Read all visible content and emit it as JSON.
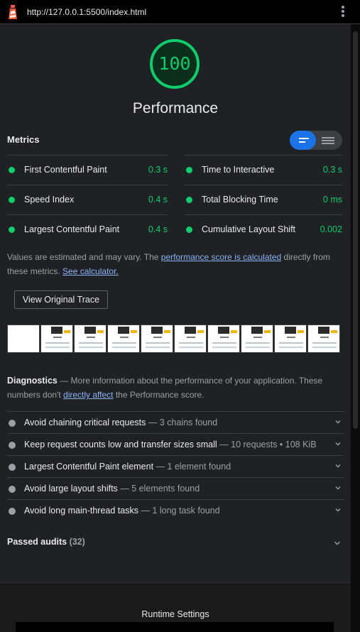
{
  "browser": {
    "url": "http://127.0.0.1:5500/index.html",
    "logo_icon": "lighthouse-icon",
    "menu_icon": "kebab-menu-icon"
  },
  "category": {
    "score": "100",
    "title": "Performance",
    "score_color": "#0cce6b"
  },
  "metrics": {
    "title": "Metrics",
    "view_toggle": {
      "active": "list-view-icon",
      "inactive": "table-view-icon",
      "accent": "#1a73e8"
    },
    "left": [
      {
        "label": "First Contentful Paint",
        "value": "0.3 s"
      },
      {
        "label": "Speed Index",
        "value": "0.4 s"
      },
      {
        "label": "Largest Contentful Paint",
        "value": "0.4 s"
      }
    ],
    "right": [
      {
        "label": "Time to Interactive",
        "value": "0.3 s"
      },
      {
        "label": "Total Blocking Time",
        "value": "0 ms"
      },
      {
        "label": "Cumulative Layout Shift",
        "value": "0.002"
      }
    ],
    "pass_color": "#0cce6b"
  },
  "note": {
    "text1": "Values are estimated and may vary. The ",
    "link1": "performance score is calculated",
    "text2": " directly from these metrics. ",
    "link2": "See calculator."
  },
  "trace_button": "View Original Trace",
  "diagnostics": {
    "title": "Diagnostics",
    "dash": " — ",
    "desc1": "More information about the performance of your application. These numbers don't ",
    "link": "directly affect",
    "desc2": " the Performance score.",
    "audits": [
      {
        "title": "Avoid chaining critical requests",
        "detail": "3 chains found"
      },
      {
        "title": "Keep request counts low and transfer sizes small",
        "detail": "10 requests • 108 KiB"
      },
      {
        "title": "Largest Contentful Paint element",
        "detail": "1 element found"
      },
      {
        "title": "Avoid large layout shifts",
        "detail": "5 elements found"
      },
      {
        "title": "Avoid long main-thread tasks",
        "detail": "1 long task found"
      }
    ]
  },
  "passed": {
    "label": "Passed audits",
    "count": "(32)"
  },
  "footer": {
    "title": "Runtime Settings"
  }
}
